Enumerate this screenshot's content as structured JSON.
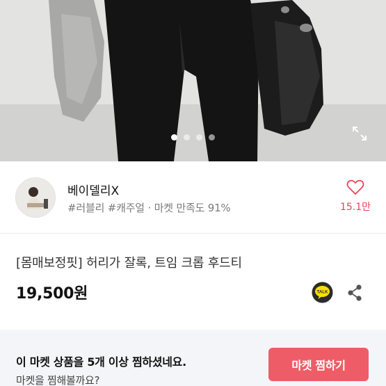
{
  "gallery": {
    "slide_count": 4,
    "active_index": 0,
    "expand_icon": "expand-icon"
  },
  "shop": {
    "name": "베이델리X",
    "tags": "#러블리 #캐주얼 · 마켓 만족도 91%",
    "like_count": "15.1만",
    "like_icon": "heart-outline-icon",
    "colors": {
      "like": "#e8435a"
    }
  },
  "product": {
    "title": "[몸매보정핏] 허리가 잘록, 트임 크롭 후드티",
    "price": "19,500원",
    "talk_label": "TALK",
    "share_icon": "share-icon"
  },
  "banner": {
    "message": "이 마켓 상품을 5개 이상 찜하셨네요.",
    "sub_message": "마켓을 찜해볼까요?",
    "button_label": "마켓 찜하기",
    "colors": {
      "button": "#ee5d67",
      "background": "#f4f5f8"
    }
  }
}
